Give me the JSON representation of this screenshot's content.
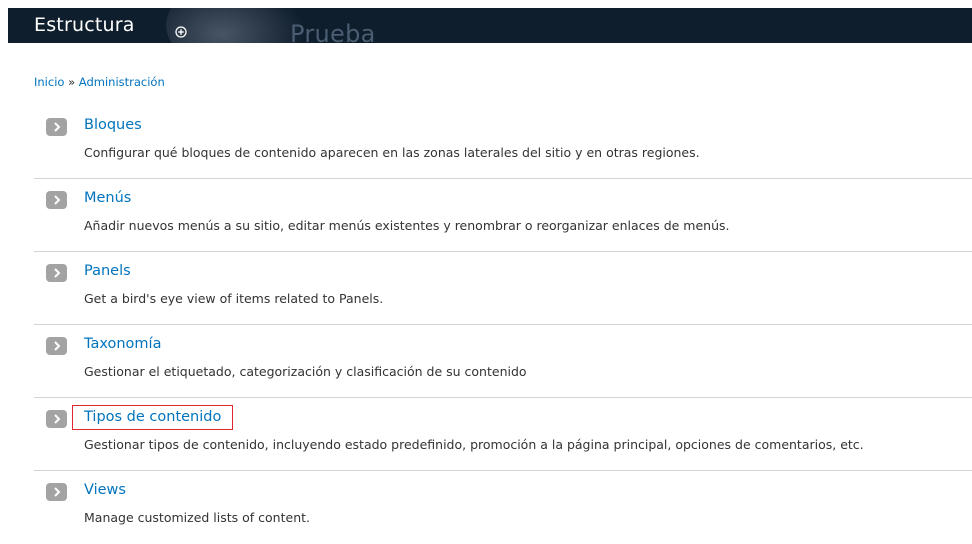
{
  "header": {
    "title": "Estructura",
    "add_icon": "circle-plus-icon",
    "site_name": "Prueba"
  },
  "breadcrumb": {
    "home": "Inicio",
    "separator": "»",
    "current": "Administración"
  },
  "colors": {
    "header_bg": "#0f1e2d",
    "link": "#0074bd",
    "bullet": "#a3a3a3",
    "highlight_border": "#e0262e",
    "divider": "#d4d4d4"
  },
  "items": [
    {
      "label": "Bloques",
      "description": "Configurar qué bloques de contenido aparecen en las zonas laterales del sitio y en otras regiones.",
      "icon": "chevron-right-icon"
    },
    {
      "label": "Menús",
      "description": "Añadir nuevos menús a su sitio, editar menús existentes y renombrar o reorganizar enlaces de menús.",
      "icon": "chevron-right-icon"
    },
    {
      "label": "Panels",
      "description": "Get a bird's eye view of items related to Panels.",
      "icon": "chevron-right-icon"
    },
    {
      "label": "Taxonomía",
      "description": "Gestionar el etiquetado, categorización y clasificación de su contenido",
      "icon": "chevron-right-icon"
    },
    {
      "label": "Tipos de contenido",
      "description": "Gestionar tipos de contenido, incluyendo estado predefinido, promoción a la página principal, opciones de comentarios, etc.",
      "icon": "chevron-right-icon",
      "highlighted": true
    },
    {
      "label": "Views",
      "description": "Manage customized lists of content.",
      "icon": "chevron-right-icon"
    }
  ]
}
